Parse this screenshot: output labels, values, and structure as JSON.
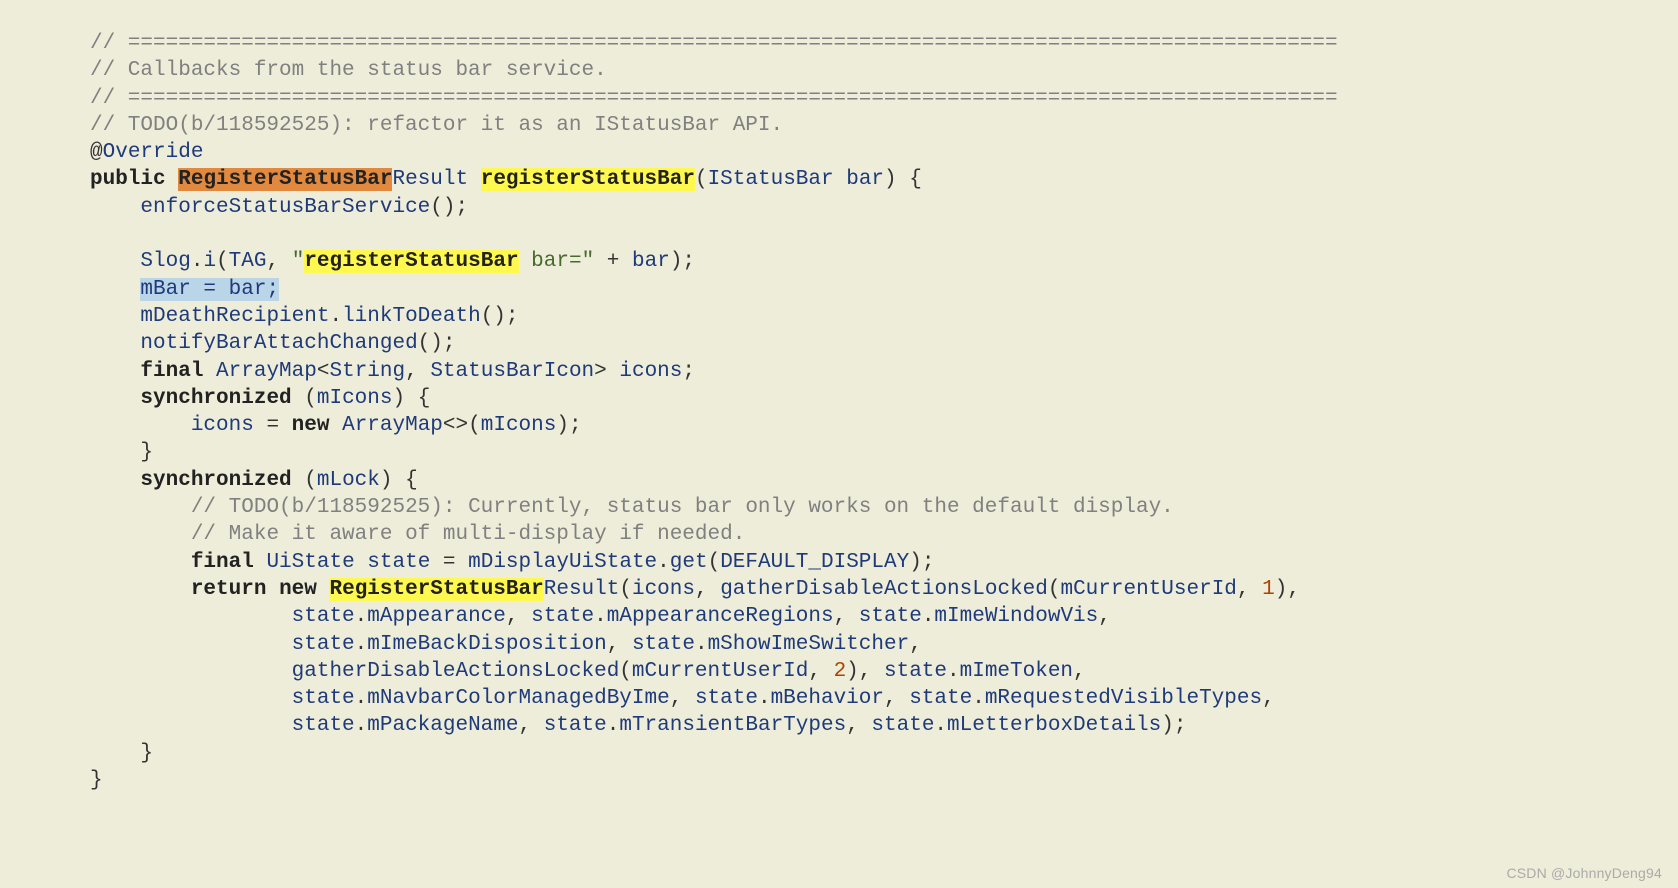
{
  "code": {
    "c1": "// ================================================================================================",
    "c2": "// Callbacks from the status bar service.",
    "c3": "// ================================================================================================",
    "c4": "// TODO(b/118592525): refactor it as an IStatusBar API.",
    "ann_at": "@",
    "ann_override": "Override",
    "kw_public": "public",
    "type_regBarRes_hl": "RegisterStatusBar",
    "type_regBarRes_suffix": "Result",
    "method_name_hl": "registerStatusBar",
    "param_type": "IStatusBar",
    "param_name": "bar",
    "call_enforce": "enforceStatusBarService",
    "slog": "Slog",
    "slog_i": "i",
    "tag": "TAG",
    "str_regBar_pre_hl": "registerStatusBar",
    "str_bar_eq": " bar=\"",
    "plus_bar": "bar",
    "mBar_assign": "mBar = bar;",
    "mDeathRecipient": "mDeathRecipient",
    "linkToDeath": "linkToDeath",
    "notifyBarAttachChanged": "notifyBarAttachChanged",
    "kw_final": "final",
    "type_ArrayMap": "ArrayMap",
    "type_String": "String",
    "type_StatusBarIcon": "StatusBarIcon",
    "var_icons": "icons",
    "kw_synchronized": "synchronized",
    "mIcons": "mIcons",
    "kw_new": "new",
    "mLock": "mLock",
    "c5": "// TODO(b/118592525): Currently, status bar only works on the default display.",
    "c6": "// Make it aware of multi-display if needed.",
    "type_UiState": "UiState",
    "var_state": "state",
    "mDisplayUiState": "mDisplayUiState",
    "get": "get",
    "DEFAULT_DISPLAY": "DEFAULT_DISPLAY",
    "kw_return": "return",
    "RegisterStatusBar_hl": "RegisterStatusBar",
    "Result_suffix": "Result",
    "gatherDisableActionsLocked": "gatherDisableActionsLocked",
    "mCurrentUserId": "mCurrentUserId",
    "num1": "1",
    "num2": "2",
    "mAppearance": "mAppearance",
    "mAppearanceRegions": "mAppearanceRegions",
    "mImeWindowVis": "mImeWindowVis",
    "mImeBackDisposition": "mImeBackDisposition",
    "mShowImeSwitcher": "mShowImeSwitcher",
    "mImeToken": "mImeToken",
    "mNavbarColorManagedByIme": "mNavbarColorManagedByIme",
    "mBehavior": "mBehavior",
    "mRequestedVisibleTypes": "mRequestedVisibleTypes",
    "mPackageName": "mPackageName",
    "mTransientBarTypes": "mTransientBarTypes",
    "mLetterboxDetails": "mLetterboxDetails"
  },
  "watermark": "CSDN @JohnnyDeng94"
}
